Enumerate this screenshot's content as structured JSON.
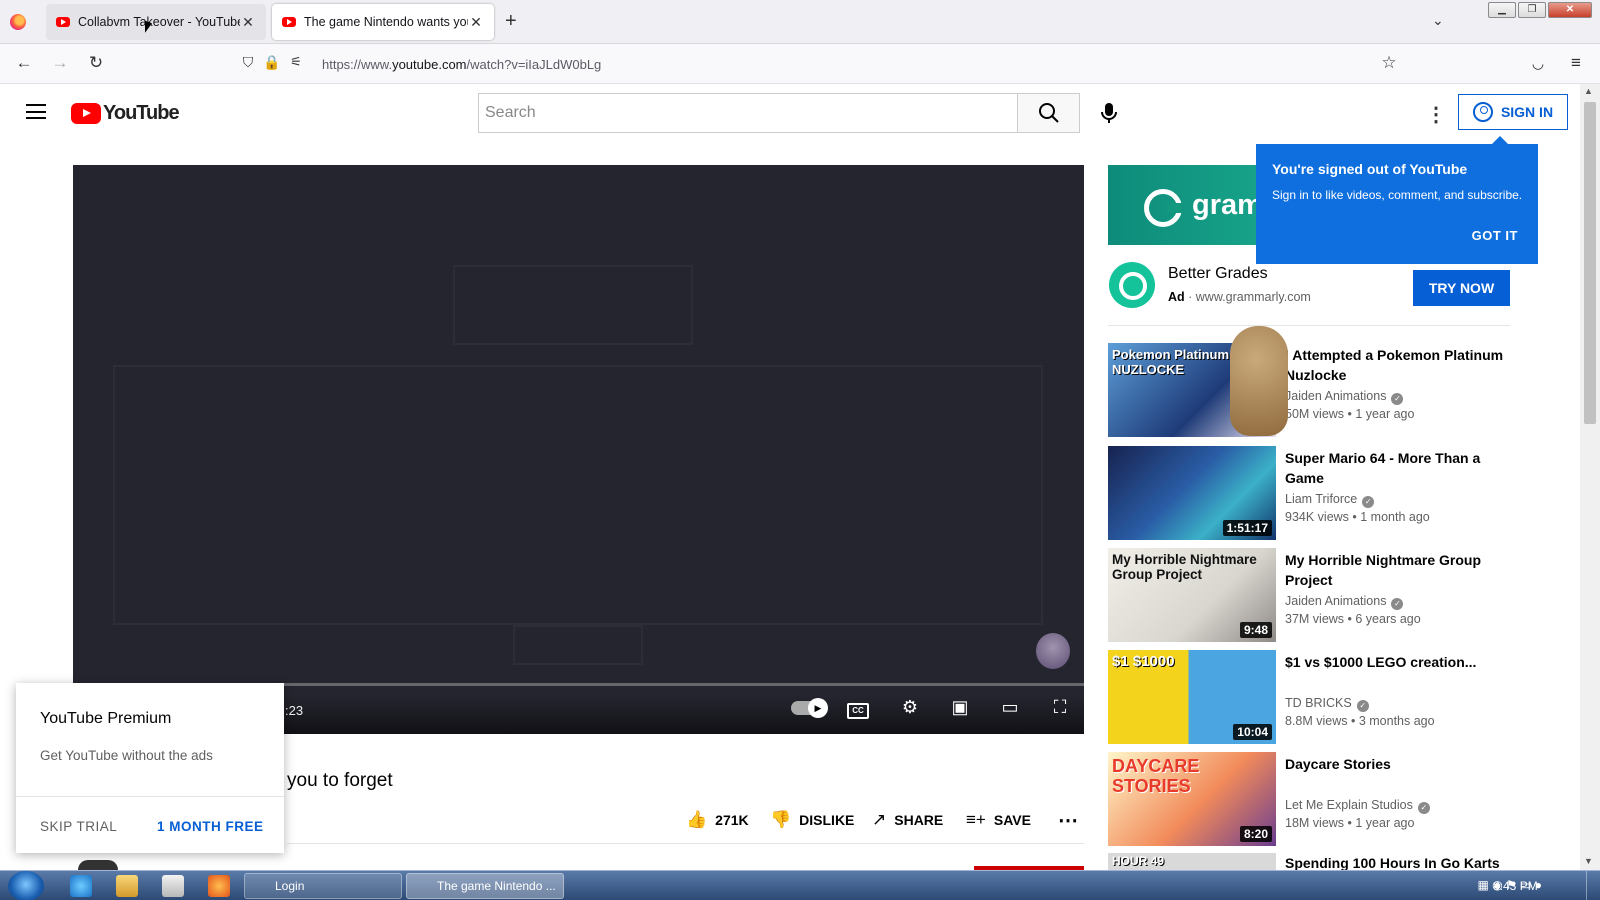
{
  "browser": {
    "tabs": [
      {
        "label": "Collabvm Takeover - YouTube",
        "active": false
      },
      {
        "label": "The game Nintendo wants you",
        "active": true
      }
    ],
    "url_prefix": "https://www.",
    "url_domain": "youtube.com",
    "url_path": "/watch?v=iIaJLdW0bLg"
  },
  "youtube": {
    "logo_text": "YouTube",
    "search_placeholder": "Search",
    "sign_in": "SIGN IN"
  },
  "player": {
    "time_fragment": ":23"
  },
  "video": {
    "title_fragment": "you to forget",
    "likes": "271K",
    "dislike": "DISLIKE",
    "share": "SHARE",
    "save": "SAVE"
  },
  "premium_popup": {
    "title": "YouTube Premium",
    "subtitle": "Get YouTube without the ads",
    "skip": "SKIP TRIAL",
    "offer": "1 MONTH FREE"
  },
  "tooltip": {
    "title": "You're signed out of YouTube",
    "body": "Sign in to like videos, comment, and subscribe.",
    "button": "GOT IT"
  },
  "ad": {
    "banner_text": "gramm",
    "headline": "Better Grades",
    "label": "Ad",
    "domain": "www.grammarly.com",
    "cta": "TRY NOW"
  },
  "recommendations": [
    {
      "title": "I Attempted a Pokemon Platinum Nuzlocke",
      "channel": "Jaiden Animations",
      "stats": "50M views • 1 year ago",
      "duration": "",
      "thumb_text": "Pokemon Platinum NUZLOCKE"
    },
    {
      "title": "Super Mario 64 - More Than a Game",
      "channel": "Liam Triforce",
      "stats": "934K views • 1 month ago",
      "duration": "1:51:17",
      "thumb_text": ""
    },
    {
      "title": "My Horrible Nightmare Group Project",
      "channel": "Jaiden Animations",
      "stats": "37M views • 6 years ago",
      "duration": "9:48",
      "thumb_text": "My Horrible Nightmare Group Project"
    },
    {
      "title": "$1 vs $1000 LEGO creation...",
      "channel": "TD BRICKS",
      "stats": "8.8M views • 3 months ago",
      "duration": "10:04",
      "thumb_text": "$1    $1000"
    },
    {
      "title": "Daycare Stories",
      "channel": "Let Me Explain Studios",
      "stats": "18M views • 1 year ago",
      "duration": "8:20",
      "thumb_text": "DAYCARE STORIES"
    },
    {
      "title": "Spending 100 Hours In Go Karts",
      "channel": "",
      "stats": "",
      "duration": "",
      "thumb_text": "HOUR 49"
    }
  ],
  "taskbar": {
    "tasks": [
      "Login",
      "The game Nintendo ..."
    ],
    "clock": "8:43 PM"
  },
  "colors": {
    "yt_red": "#ff0000",
    "link_blue": "#065fd4",
    "tooltip_blue": "#0f6fde",
    "grammarly_green": "#15c39a"
  }
}
